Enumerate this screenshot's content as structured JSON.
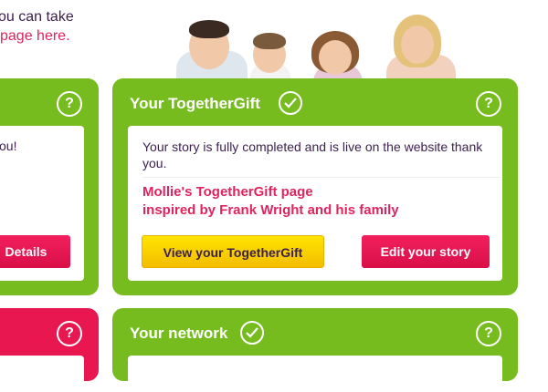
{
  "intro": {
    "line1": "ou can take",
    "line2": "page here."
  },
  "left_panel": {
    "text_fragment": "ou!",
    "button_label": "Details"
  },
  "together_gift": {
    "title": "Your TogetherGift",
    "help_label": "?",
    "story_status": "Your story is fully completed and is live on the website thank you.",
    "page_name": "Mollie's TogetherGift page",
    "inspiration": "inspired by Frank Wright and his family",
    "view_button": "View your TogetherGift",
    "edit_button": "Edit your story"
  },
  "network": {
    "title": "Your network",
    "help_label": "?"
  },
  "bottom_left_panel": {
    "help_label": "?"
  },
  "colors": {
    "green": "#77bc1f",
    "pink": "#e0245e",
    "yellow": "#ffe400",
    "text": "#3b1f4d"
  }
}
